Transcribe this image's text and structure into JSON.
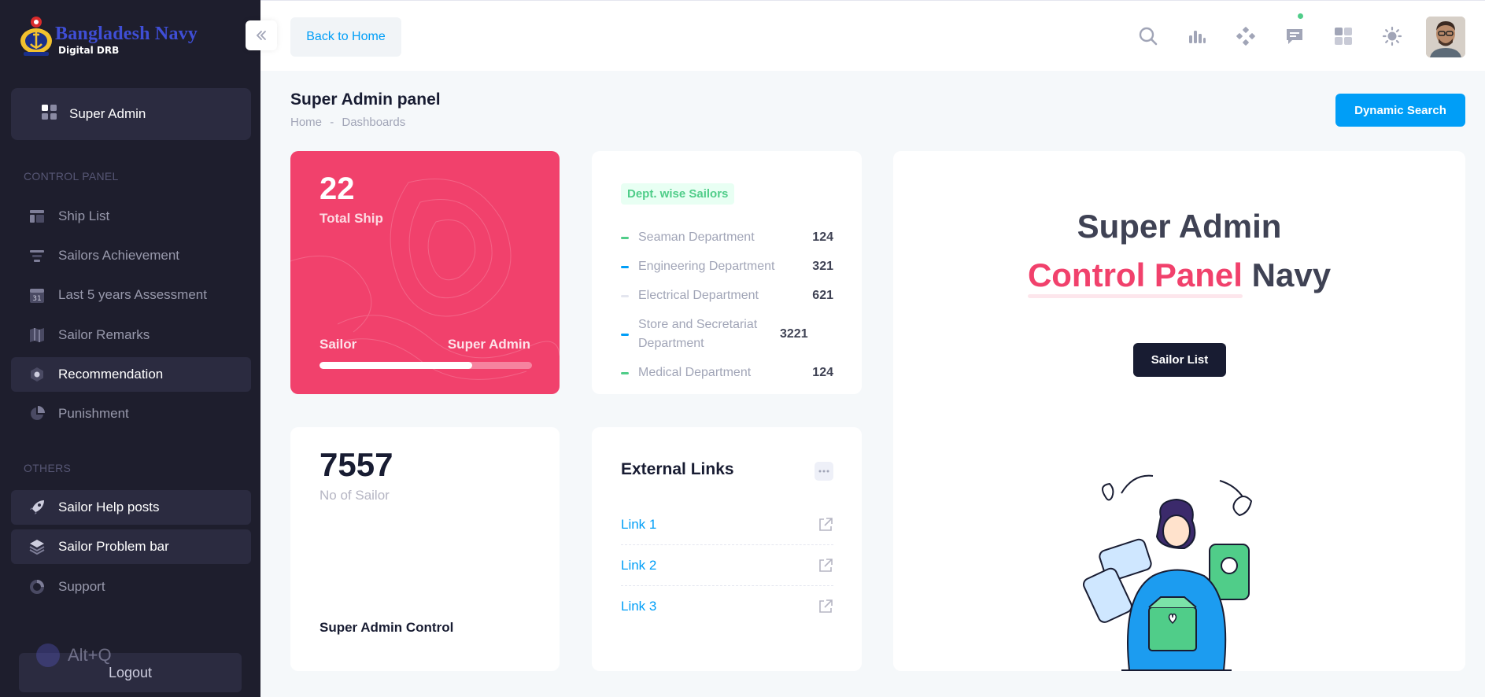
{
  "app": {
    "name": "Bangladesh Navy",
    "subtitle": "Digital DRB"
  },
  "sidebar": {
    "top_item": {
      "label": "Super Admin",
      "icon": "grid-icon"
    },
    "sections": [
      {
        "title": "CONTROL PANEL",
        "items": [
          {
            "label": "Ship List",
            "icon": "layout-icon"
          },
          {
            "label": "Sailors Achievement",
            "icon": "align-icon"
          },
          {
            "label": "Last 5 years Assessment",
            "icon": "calendar-icon",
            "icon_text": "31"
          },
          {
            "label": "Sailor Remarks",
            "icon": "map-icon"
          },
          {
            "label": "Recommendation",
            "icon": "hexagon-icon",
            "active": true
          },
          {
            "label": "Punishment",
            "icon": "pie-chart-icon"
          }
        ]
      },
      {
        "title": "OTHERS",
        "items": [
          {
            "label": "Sailor Help posts",
            "icon": "rocket-icon",
            "active": true
          },
          {
            "label": "Sailor Problem bar",
            "icon": "layers-icon",
            "active": true
          },
          {
            "label": "Support",
            "icon": "support-icon"
          }
        ]
      }
    ],
    "logout_label": "Logout",
    "shortcut_hint": "Alt+Q"
  },
  "header": {
    "back_label": "Back to Home",
    "icons": [
      "search-icon",
      "chart-icon",
      "apps-icon",
      "chat-icon",
      "dashboard-icon",
      "theme-icon"
    ]
  },
  "toolbar": {
    "title": "Super Admin panel",
    "breadcrumb": [
      "Home",
      "-",
      "Dashboards"
    ],
    "dynamic_search_label": "Dynamic Search"
  },
  "ship_card": {
    "value": "22",
    "label": "Total Ship",
    "footer_left": "Sailor",
    "footer_right": "Super Admin",
    "progress": 0.72,
    "color": "#f1416c"
  },
  "dept_card": {
    "badge": "Dept. wise Sailors",
    "rows": [
      {
        "name": "Seaman Department",
        "value": "124",
        "color": "#50cd89"
      },
      {
        "name": "Engineering Department",
        "value": "321",
        "color": "#009ef7"
      },
      {
        "name": "Electrical Department",
        "value": "621",
        "color": "#e4e6ef"
      },
      {
        "name": "Store and Secretariat Department",
        "value": "3221",
        "color": "#009ef7"
      },
      {
        "name": "Medical Department",
        "value": "124",
        "color": "#50cd89"
      }
    ]
  },
  "hero": {
    "line1": "Super Admin",
    "line2_highlight": "Control Panel",
    "line2_rest": "Navy",
    "button_label": "Sailor List"
  },
  "sailor_card": {
    "value": "7557",
    "label": "No of Sailor",
    "footer": "Super Admin Control"
  },
  "links_card": {
    "title": "External Links",
    "links": [
      "Link 1",
      "Link 2",
      "Link 3"
    ]
  }
}
